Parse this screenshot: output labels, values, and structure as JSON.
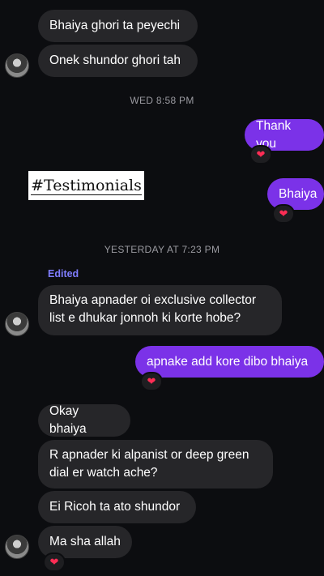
{
  "messages": {
    "m1": "Bhaiya ghori ta peyechi",
    "m2": "Onek shundor ghori tah",
    "m3": "Thank you",
    "m4": "Bhaiya",
    "m5": "Bhaiya apnader oi exclusive collector list e dhukar jonnoh ki korte hobe?",
    "m6": "apnake add kore dibo bhaiya",
    "m7": "Okay bhaiya",
    "m8": "R apnader ki alpanist or deep green dial er watch ache?",
    "m9": "Ei Ricoh ta ato shundor",
    "m10": "Ma sha allah"
  },
  "timestamps": {
    "t1": "WED 8:58 PM",
    "t2": "YESTERDAY AT 7:23 PM"
  },
  "edited_label": "Edited",
  "overlay_text": "#Testimonials",
  "reaction_emoji": "❤",
  "colors": {
    "background": "#0c0d10",
    "incoming_bubble": "#262629",
    "outgoing_bubble": "#7b32e8",
    "edited_label": "#7f7dff",
    "heart": "#ff2d55"
  },
  "icons": [
    "avatar",
    "heart-icon"
  ]
}
